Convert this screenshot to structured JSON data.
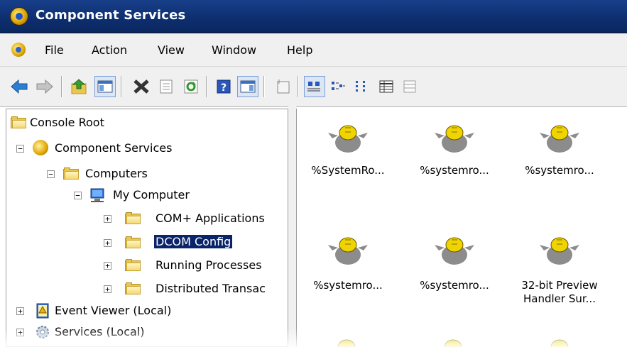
{
  "window": {
    "title": "Component Services"
  },
  "menu": [
    "File",
    "Action",
    "View",
    "Window",
    "Help"
  ],
  "tree": {
    "console_root": "Console Root",
    "component_services": "Component Services",
    "computers": "Computers",
    "my_computer": "My Computer",
    "com_apps": "COM+ Applications",
    "dcom_config": "DCOM Config",
    "running_processes": "Running Processes",
    "distributed_transac": "Distributed Transac",
    "event_viewer": "Event Viewer (Local)",
    "services": "Services (Local)"
  },
  "items": [
    "%SystemRo...",
    "%systemro...",
    "%systemro...",
    "%systemro...",
    "%systemro...",
    "32-bit Preview\nHandler Sur..."
  ],
  "colors": {
    "titlebar": "#0d2e6e",
    "selection": "#0a246a",
    "folder": "#e8c64f"
  }
}
